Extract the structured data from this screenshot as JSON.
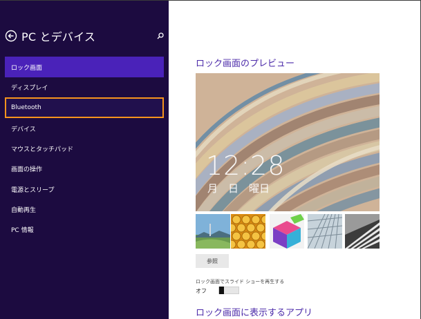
{
  "sidebar": {
    "title": "PC とデバイス",
    "items": [
      {
        "label": "ロック画面"
      },
      {
        "label": "ディスプレイ"
      },
      {
        "label": "Bluetooth"
      },
      {
        "label": "デバイス"
      },
      {
        "label": "マウスとタッチパッド"
      },
      {
        "label": "画面の操作"
      },
      {
        "label": "電源とスリープ"
      },
      {
        "label": "自動再生"
      },
      {
        "label": "PC 情報"
      }
    ],
    "selected_index": 0,
    "highlighted_index": 2
  },
  "main": {
    "preview_title": "ロック画面のプレビュー",
    "preview_time": "12:28",
    "preview_date": "月　日　曜日",
    "thumbnails": [
      "landscape-city",
      "honeycomb",
      "color-cubes",
      "glass-roof",
      "piano-keys"
    ],
    "browse_label": "参照",
    "slideshow_label": "ロック画面でスライド ショーを再生する",
    "slideshow_state": "オフ",
    "apps_title": "ロック画面に表示するアプリ"
  },
  "colors": {
    "sidebar_bg": "#1c0b40",
    "selected_bg": "#4a22b9",
    "highlight_border": "#f7941d",
    "heading": "#4b2aa9"
  }
}
